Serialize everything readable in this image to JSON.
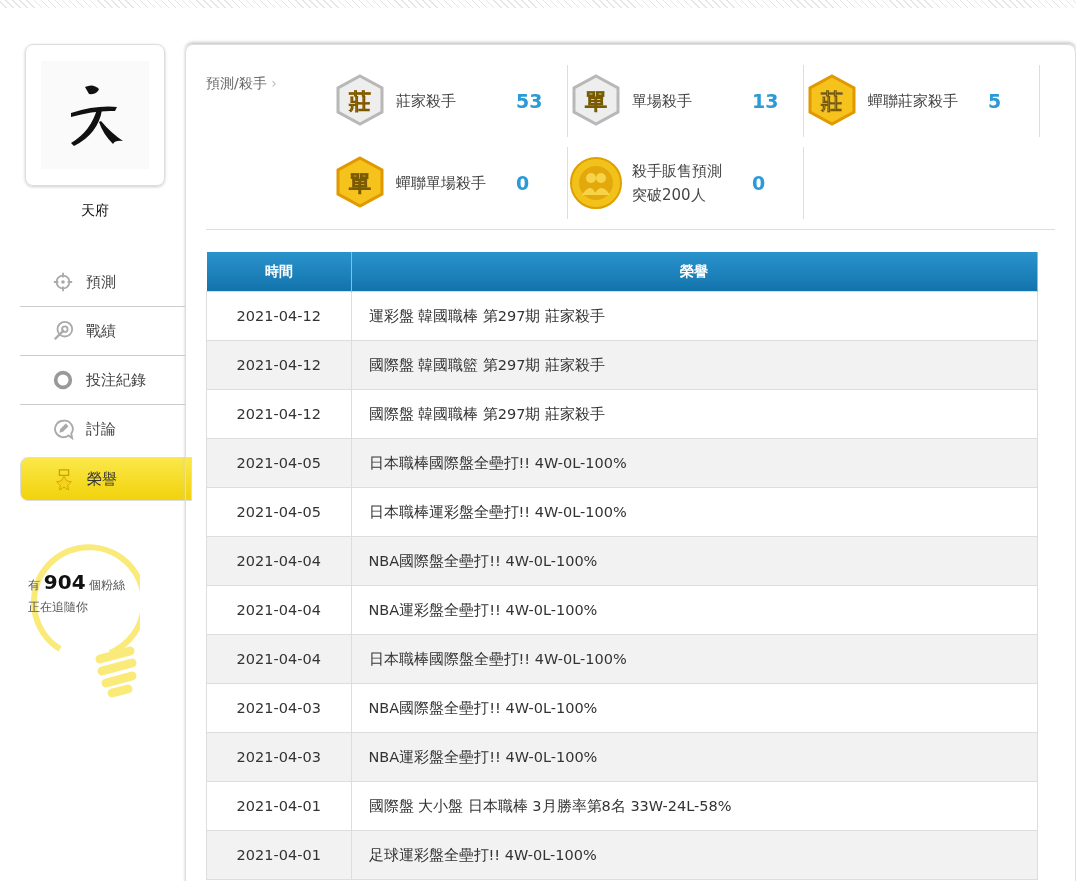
{
  "profile": {
    "name": "天府"
  },
  "nav": [
    {
      "label": "預測",
      "selected": false
    },
    {
      "label": "戰績",
      "selected": false
    },
    {
      "label": "投注紀錄",
      "selected": false
    },
    {
      "label": "討論",
      "selected": false
    },
    {
      "label": "榮譽",
      "selected": true
    }
  ],
  "fans": {
    "text": "有 **904** 個粉絲正在追隨你"
  },
  "breadcrumb": {
    "label": "預測/殺手",
    "arrow": "›"
  },
  "badges": [
    {
      "kind": "silver",
      "glyph": "莊",
      "label": "莊家殺手",
      "count": "53"
    },
    {
      "kind": "silver",
      "glyph": "單",
      "label": "單場殺手",
      "count": "13"
    },
    {
      "kind": "gold-red",
      "glyph": "莊",
      "label": "蟬聯莊家殺手",
      "count": "5"
    },
    {
      "kind": "gold-blue",
      "glyph": "單",
      "label": "蟬聯單場殺手",
      "count": "0"
    },
    {
      "kind": "coin",
      "label": "殺手販售預測突破200人",
      "count": "0"
    }
  ],
  "table": {
    "columns": [
      "時間",
      "榮譽"
    ],
    "rows": [
      [
        "2021-04-12",
        "運彩盤 韓國職棒 第297期 莊家殺手"
      ],
      [
        "2021-04-12",
        "國際盤 韓國職籃 第297期 莊家殺手"
      ],
      [
        "2021-04-12",
        "國際盤 韓國職棒 第297期 莊家殺手"
      ],
      [
        "2021-04-05",
        "日本職棒國際盤全壘打!! 4W-0L-100%"
      ],
      [
        "2021-04-05",
        "日本職棒運彩盤全壘打!! 4W-0L-100%"
      ],
      [
        "2021-04-04",
        "NBA國際盤全壘打!! 4W-0L-100%"
      ],
      [
        "2021-04-04",
        "NBA運彩盤全壘打!! 4W-0L-100%"
      ],
      [
        "2021-04-04",
        "日本職棒國際盤全壘打!! 4W-0L-100%"
      ],
      [
        "2021-04-03",
        "NBA國際盤全壘打!! 4W-0L-100%"
      ],
      [
        "2021-04-03",
        "NBA運彩盤全壘打!! 4W-0L-100%"
      ],
      [
        "2021-04-01",
        "國際盤 大小盤 日本職棒 3月勝率第8名 33W-24L-58%"
      ],
      [
        "2021-04-01",
        "足球運彩盤全壘打!! 4W-0L-100%"
      ]
    ]
  }
}
